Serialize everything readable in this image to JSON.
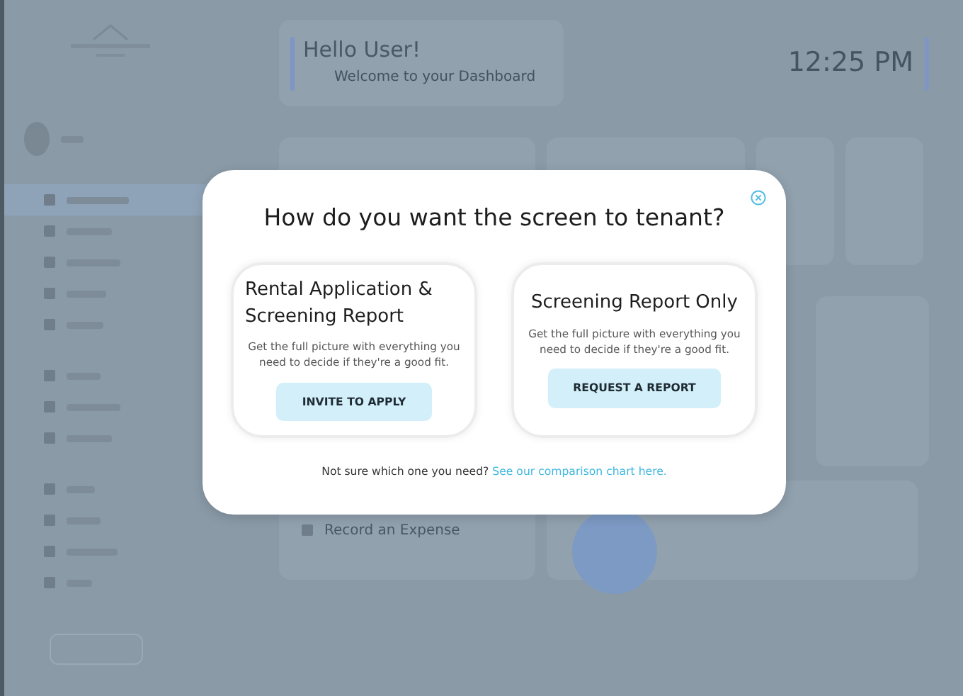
{
  "dashboard": {
    "greeting": "Hello User!",
    "subtitle": "Welcome to your Dashboard",
    "time": "12:25 PM",
    "quick_action": "Record an Expense"
  },
  "sidebar": {
    "items": [
      {
        "selected": true
      },
      {
        "selected": false
      },
      {
        "selected": false
      },
      {
        "selected": false
      },
      {
        "selected": false
      },
      {
        "selected": false
      },
      {
        "selected": false
      },
      {
        "selected": false
      },
      {
        "selected": false
      },
      {
        "selected": false
      },
      {
        "selected": false
      },
      {
        "selected": false
      }
    ]
  },
  "modal": {
    "title": "How do you want the screen to tenant?",
    "options": [
      {
        "title": "Rental Application & Screening Report",
        "description": "Get the full picture with everything you need to decide if they're a good fit.",
        "button": "INVITE TO APPLY"
      },
      {
        "title": "Screening Report Only",
        "description": "Get the full picture with everything you need to decide if they're a good fit.",
        "button": "REQUEST A REPORT"
      }
    ],
    "footer": {
      "text": "Not sure which one you need?",
      "link": "See our comparison chart here."
    }
  }
}
